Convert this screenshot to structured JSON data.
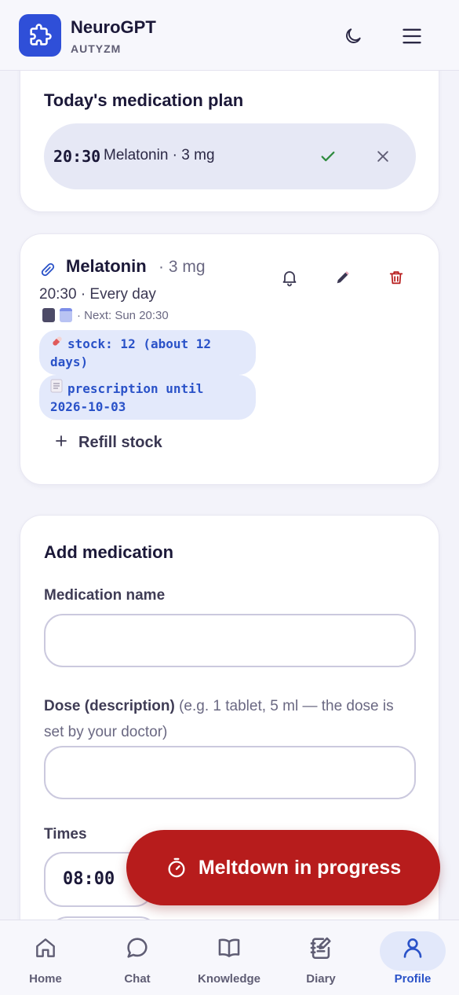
{
  "app": {
    "title": "NeuroGPT",
    "subtitle": "AUTYZM"
  },
  "today_plan": {
    "title": "Today's medication plan",
    "entry": {
      "time": "20:30",
      "name": "Melatonin · 3 mg"
    }
  },
  "medication": {
    "name": "Melatonin",
    "dose": "· 3 mg",
    "schedule": "20:30 · Every day",
    "next": "· Next: Sun 20:30",
    "stock": "stock: 12 (about 12 days)",
    "prescription": "prescription until 2026-10-03",
    "refill_label": "Refill stock"
  },
  "add_medication": {
    "title": "Add medication",
    "name_label": "Medication name",
    "dose_label": "Dose (description)",
    "dose_hint": "(e.g. 1 tablet, 5 ml — the dose is set by your doctor)",
    "times_label": "Times",
    "time_value": "08:00"
  },
  "meltdown": {
    "label": "Meltdown in progress"
  },
  "nav": {
    "items": [
      {
        "label": "Home",
        "icon": "home-icon"
      },
      {
        "label": "Chat",
        "icon": "chat-icon"
      },
      {
        "label": "Knowledge",
        "icon": "book-icon"
      },
      {
        "label": "Diary",
        "icon": "notebook-icon"
      },
      {
        "label": "Profile",
        "icon": "user-icon"
      }
    ],
    "active": "Profile"
  },
  "colors": {
    "brand": "#2f4fd8",
    "accent": "#2a52c8",
    "danger": "#b71c1c",
    "success": "#2e8b3e"
  }
}
